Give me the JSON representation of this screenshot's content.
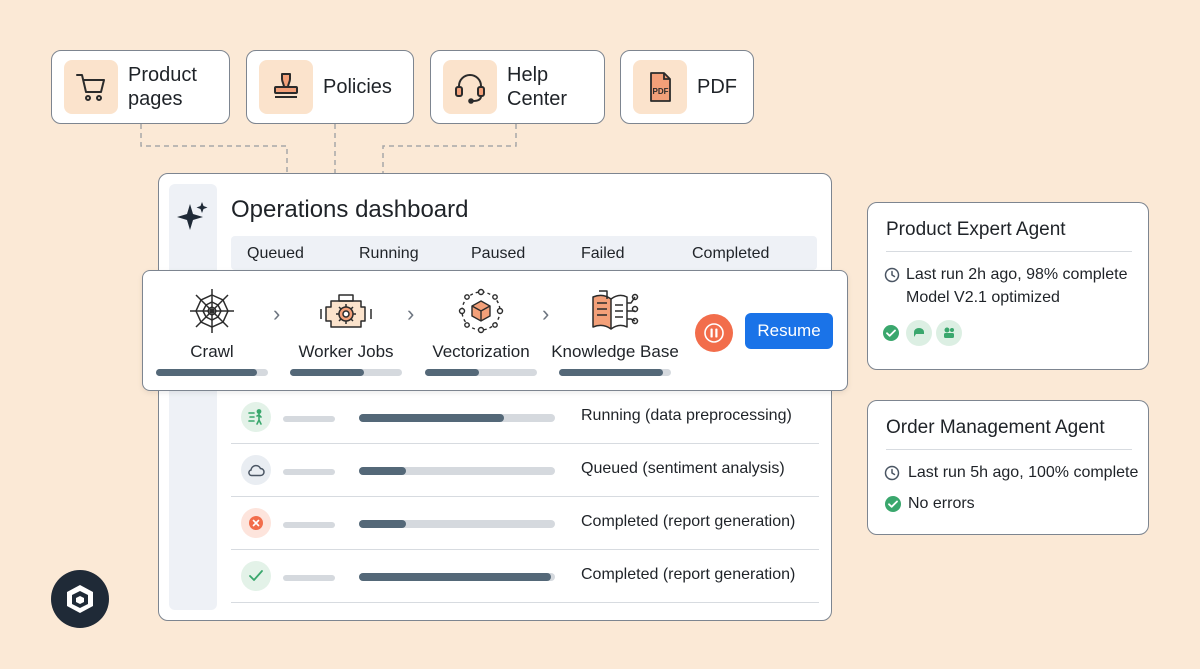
{
  "sources": [
    {
      "label": "Product\npages",
      "icon": "shopping-cart-icon"
    },
    {
      "label": "Policies",
      "icon": "stamp-icon"
    },
    {
      "label": "Help\nCenter",
      "icon": "headset-icon"
    },
    {
      "label": "PDF",
      "icon": "pdf-file-icon",
      "badge": "PDF"
    }
  ],
  "dashboard": {
    "title": "Operations dashboard",
    "tabs": [
      "Queued",
      "Running",
      "Paused",
      "Failed",
      "Completed"
    ],
    "rows": [
      {
        "status": "Running (data preprocessing)",
        "icon": "run-icon",
        "progress": 0.74
      },
      {
        "status": "Queued (sentiment analysis)",
        "icon": "cloud-icon",
        "progress": 0.24
      },
      {
        "status": "Completed (report generation)",
        "icon": "error-icon",
        "progress": 0.24
      },
      {
        "status": "Completed (report generation)",
        "icon": "check-icon",
        "progress": 0.98
      }
    ]
  },
  "pipeline": {
    "stages": [
      {
        "label": "Crawl",
        "icon": "spider-web-icon",
        "progress": 0.9
      },
      {
        "label": "Worker Jobs",
        "icon": "engine-gear-icon",
        "progress": 0.66
      },
      {
        "label": "Vectorization",
        "icon": "vector-cube-icon",
        "progress": 0.48
      },
      {
        "label": "Knowledge Base",
        "icon": "knowledge-book-icon",
        "progress": 0.93
      }
    ],
    "resume_label": "Resume"
  },
  "agents": {
    "product": {
      "title": "Product Expert Agent",
      "last_run": "Last run 2h ago, 98% complete",
      "model": "Model V2.1 optimized"
    },
    "order": {
      "title": "Order Management Agent",
      "last_run": "Last run 5h ago, 100% complete",
      "errors": "No errors"
    }
  },
  "colors": {
    "background": "#fbe9d6",
    "accent_orange": "#f26d4b",
    "primary_blue": "#1a73e8",
    "success_green": "#3aa76d",
    "progress": "#546878"
  }
}
